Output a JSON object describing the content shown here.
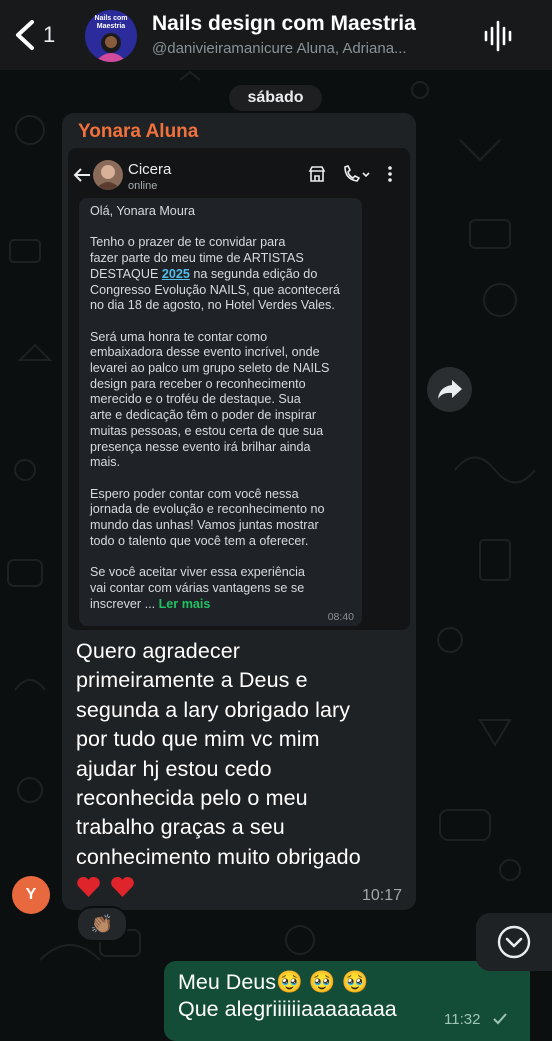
{
  "header": {
    "unread_count": "1",
    "title": "Nails design com Maestria",
    "subtitle": "@danivieiramanicure Aluna, Adriana...",
    "avatar_text": "Nails com Maestria"
  },
  "date_separator": "sábado",
  "incoming_message": {
    "sender": "Yonara Aluna",
    "sender_initial": "Y",
    "embedded_chat": {
      "contact_name": "Cicera",
      "contact_status": "online",
      "message_intro": "Olá, Yonara Moura\n\nTenho o prazer de te convidar para\nfazer parte do meu time de ARTISTAS\nDESTAQUE ",
      "message_year": "2025",
      "message_body": " na segunda edição do\nCongresso Evolução NAILS, que acontecerá\nno dia 18 de agosto, no Hotel Verdes Vales.\n\nSerá uma honra te contar como\nembaixadora desse evento incrível, onde\nlevarei ao palco um grupo seleto de NAILS\ndesign para receber o reconhecimento\nmerecido e o troféu de destaque. Sua\narte e dedicação têm o poder de inspirar\nmuitas pessoas, e estou certa de que sua\npresença nesse evento irá brilhar ainda\nmais.\n\nEspero poder contar com você nessa\njornada de evolução e reconhecimento no\nmundo das unhas! Vamos juntas mostrar\ntodo o talento que você tem a oferecer.\n\nSe você aceitar viver essa experiência\nvai contar com várias vantagens se se\ninscrever ... ",
      "read_more": "Ler mais",
      "time": "08:40"
    },
    "caption": "Quero agradecer\nprimeiramente a Deus e\nsegunda a lary obrigado lary\npor tudo que mim vc mim\najudar hj estou cedo\nreconhecida pelo o meu\ntrabalho graças a seu\nconhecimento muito obrigado",
    "time": "10:17",
    "reaction": "👏🏽"
  },
  "outgoing_message": {
    "text": "Meu Deus🥹 🥹 🥹\nQue alegriiiiiiaaaaaaaa",
    "time": "11:32"
  },
  "colors": {
    "background": "#0c0f10",
    "header": "#17191b",
    "incoming_bubble": "#1f2224",
    "outgoing_bubble": "#144d37",
    "sender_name": "#f1713c",
    "link": "#53bdeb",
    "read_more": "#21c063"
  },
  "icons": [
    "back-chevron-icon",
    "waveform-icon",
    "shop-icon",
    "phone-icon",
    "more-vertical-icon",
    "forward-icon",
    "chevron-down-circle-icon",
    "heart-icon",
    "check-icon"
  ]
}
